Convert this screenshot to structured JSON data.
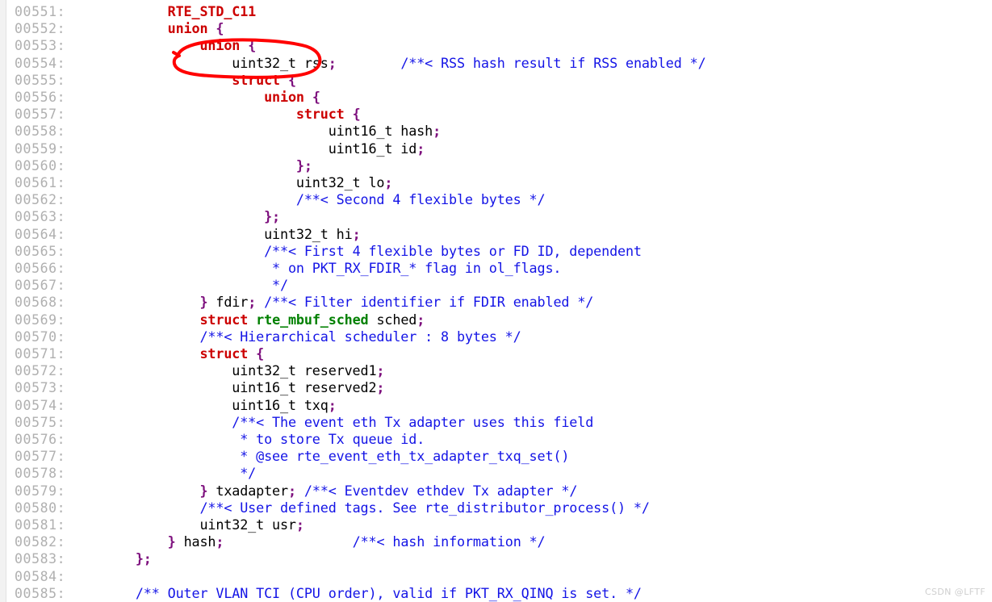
{
  "viewer": {
    "title": "rte_mbuf.h code listing",
    "background_color": "#ffffff",
    "gutter_color": "#f2f2f2",
    "first_line": "00551",
    "last_line": "00585"
  },
  "colors": {
    "keyword": "#cc0000",
    "type": "#008000",
    "punctuation": "#7d0f7d",
    "comment": "#1414e6",
    "plain": "#000000",
    "line_number": "#b0b0b0",
    "annotation": "#ff0000",
    "watermark": "#cfcfcf"
  },
  "annotation": {
    "shape": "hand-drawn-ellipse",
    "color": "#ff0000",
    "encircles": "uint32_t rss;",
    "target_line": "00554"
  },
  "watermark": {
    "text": "CSDN @LFTF"
  },
  "lines": [
    {
      "no": "00551:",
      "tokens": [
        {
          "t": "plain",
          "s": "        "
        },
        {
          "t": "kw",
          "s": "RTE_STD_C11"
        }
      ]
    },
    {
      "no": "00552:",
      "tokens": [
        {
          "t": "plain",
          "s": "        "
        },
        {
          "t": "kw",
          "s": "union"
        },
        {
          "t": "plain",
          "s": " "
        },
        {
          "t": "punc",
          "s": "{"
        }
      ]
    },
    {
      "no": "00553:",
      "tokens": [
        {
          "t": "plain",
          "s": "            "
        },
        {
          "t": "kw",
          "s": "union"
        },
        {
          "t": "plain",
          "s": " "
        },
        {
          "t": "punc",
          "s": "{"
        }
      ]
    },
    {
      "no": "00554:",
      "tokens": [
        {
          "t": "plain",
          "s": "                uint32_t rss"
        },
        {
          "t": "punc",
          "s": ";"
        },
        {
          "t": "plain",
          "s": "        "
        },
        {
          "t": "cmt",
          "s": "/**< RSS hash result if RSS enabled */"
        }
      ]
    },
    {
      "no": "00555:",
      "tokens": [
        {
          "t": "plain",
          "s": "                "
        },
        {
          "t": "kw",
          "s": "struct"
        },
        {
          "t": "plain",
          "s": " "
        },
        {
          "t": "punc",
          "s": "{"
        }
      ]
    },
    {
      "no": "00556:",
      "tokens": [
        {
          "t": "plain",
          "s": "                    "
        },
        {
          "t": "kw",
          "s": "union"
        },
        {
          "t": "plain",
          "s": " "
        },
        {
          "t": "punc",
          "s": "{"
        }
      ]
    },
    {
      "no": "00557:",
      "tokens": [
        {
          "t": "plain",
          "s": "                        "
        },
        {
          "t": "kw",
          "s": "struct"
        },
        {
          "t": "plain",
          "s": " "
        },
        {
          "t": "punc",
          "s": "{"
        }
      ]
    },
    {
      "no": "00558:",
      "tokens": [
        {
          "t": "plain",
          "s": "                            uint16_t hash"
        },
        {
          "t": "punc",
          "s": ";"
        }
      ]
    },
    {
      "no": "00559:",
      "tokens": [
        {
          "t": "plain",
          "s": "                            uint16_t id"
        },
        {
          "t": "punc",
          "s": ";"
        }
      ]
    },
    {
      "no": "00560:",
      "tokens": [
        {
          "t": "plain",
          "s": "                        "
        },
        {
          "t": "punc",
          "s": "};"
        }
      ]
    },
    {
      "no": "00561:",
      "tokens": [
        {
          "t": "plain",
          "s": "                        uint32_t lo"
        },
        {
          "t": "punc",
          "s": ";"
        }
      ]
    },
    {
      "no": "00562:",
      "tokens": [
        {
          "t": "plain",
          "s": "                        "
        },
        {
          "t": "cmt",
          "s": "/**< Second 4 flexible bytes */"
        }
      ]
    },
    {
      "no": "00563:",
      "tokens": [
        {
          "t": "plain",
          "s": "                    "
        },
        {
          "t": "punc",
          "s": "};"
        }
      ]
    },
    {
      "no": "00564:",
      "tokens": [
        {
          "t": "plain",
          "s": "                    uint32_t hi"
        },
        {
          "t": "punc",
          "s": ";"
        }
      ]
    },
    {
      "no": "00565:",
      "tokens": [
        {
          "t": "plain",
          "s": "                    "
        },
        {
          "t": "cmt",
          "s": "/**< First 4 flexible bytes or FD ID, dependent"
        }
      ]
    },
    {
      "no": "00566:",
      "tokens": [
        {
          "t": "plain",
          "s": "                     "
        },
        {
          "t": "cmt",
          "s": "* on PKT_RX_FDIR_* flag in ol_flags."
        }
      ]
    },
    {
      "no": "00567:",
      "tokens": [
        {
          "t": "plain",
          "s": "                     "
        },
        {
          "t": "cmt",
          "s": "*/"
        }
      ]
    },
    {
      "no": "00568:",
      "tokens": [
        {
          "t": "plain",
          "s": "            "
        },
        {
          "t": "punc",
          "s": "}"
        },
        {
          "t": "plain",
          "s": " fdir"
        },
        {
          "t": "punc",
          "s": ";"
        },
        {
          "t": "plain",
          "s": " "
        },
        {
          "t": "cmt",
          "s": "/**< Filter identifier if FDIR enabled */"
        }
      ]
    },
    {
      "no": "00569:",
      "tokens": [
        {
          "t": "plain",
          "s": "            "
        },
        {
          "t": "kw",
          "s": "struct"
        },
        {
          "t": "plain",
          "s": " "
        },
        {
          "t": "type",
          "s": "rte_mbuf_sched"
        },
        {
          "t": "plain",
          "s": " sched"
        },
        {
          "t": "punc",
          "s": ";"
        }
      ]
    },
    {
      "no": "00570:",
      "tokens": [
        {
          "t": "plain",
          "s": "            "
        },
        {
          "t": "cmt",
          "s": "/**< Hierarchical scheduler : 8 bytes */"
        }
      ]
    },
    {
      "no": "00571:",
      "tokens": [
        {
          "t": "plain",
          "s": "            "
        },
        {
          "t": "kw",
          "s": "struct"
        },
        {
          "t": "plain",
          "s": " "
        },
        {
          "t": "punc",
          "s": "{"
        }
      ]
    },
    {
      "no": "00572:",
      "tokens": [
        {
          "t": "plain",
          "s": "                uint32_t reserved1"
        },
        {
          "t": "punc",
          "s": ";"
        }
      ]
    },
    {
      "no": "00573:",
      "tokens": [
        {
          "t": "plain",
          "s": "                uint16_t reserved2"
        },
        {
          "t": "punc",
          "s": ";"
        }
      ]
    },
    {
      "no": "00574:",
      "tokens": [
        {
          "t": "plain",
          "s": "                uint16_t txq"
        },
        {
          "t": "punc",
          "s": ";"
        }
      ]
    },
    {
      "no": "00575:",
      "tokens": [
        {
          "t": "plain",
          "s": "                "
        },
        {
          "t": "cmt",
          "s": "/**< The event eth Tx adapter uses this field"
        }
      ]
    },
    {
      "no": "00576:",
      "tokens": [
        {
          "t": "plain",
          "s": "                 "
        },
        {
          "t": "cmt",
          "s": "* to store Tx queue id."
        }
      ]
    },
    {
      "no": "00577:",
      "tokens": [
        {
          "t": "plain",
          "s": "                 "
        },
        {
          "t": "cmt",
          "s": "* @see rte_event_eth_tx_adapter_txq_set()"
        }
      ]
    },
    {
      "no": "00578:",
      "tokens": [
        {
          "t": "plain",
          "s": "                 "
        },
        {
          "t": "cmt",
          "s": "*/"
        }
      ]
    },
    {
      "no": "00579:",
      "tokens": [
        {
          "t": "plain",
          "s": "            "
        },
        {
          "t": "punc",
          "s": "}"
        },
        {
          "t": "plain",
          "s": " txadapter"
        },
        {
          "t": "punc",
          "s": ";"
        },
        {
          "t": "plain",
          "s": " "
        },
        {
          "t": "cmt",
          "s": "/**< Eventdev ethdev Tx adapter */"
        }
      ]
    },
    {
      "no": "00580:",
      "tokens": [
        {
          "t": "plain",
          "s": "            "
        },
        {
          "t": "cmt",
          "s": "/**< User defined tags. See rte_distributor_process() */"
        }
      ]
    },
    {
      "no": "00581:",
      "tokens": [
        {
          "t": "plain",
          "s": "            uint32_t usr"
        },
        {
          "t": "punc",
          "s": ";"
        }
      ]
    },
    {
      "no": "00582:",
      "tokens": [
        {
          "t": "plain",
          "s": "        "
        },
        {
          "t": "punc",
          "s": "}"
        },
        {
          "t": "plain",
          "s": " hash"
        },
        {
          "t": "punc",
          "s": ";"
        },
        {
          "t": "plain",
          "s": "                "
        },
        {
          "t": "cmt",
          "s": "/**< hash information */"
        }
      ]
    },
    {
      "no": "00583:",
      "tokens": [
        {
          "t": "plain",
          "s": "    "
        },
        {
          "t": "punc",
          "s": "};"
        }
      ]
    },
    {
      "no": "00584:",
      "tokens": []
    },
    {
      "no": "00585:",
      "tokens": [
        {
          "t": "plain",
          "s": "    "
        },
        {
          "t": "cmt",
          "s": "/** Outer VLAN TCI (CPU order), valid if PKT_RX_QINQ is set. */"
        }
      ]
    }
  ]
}
